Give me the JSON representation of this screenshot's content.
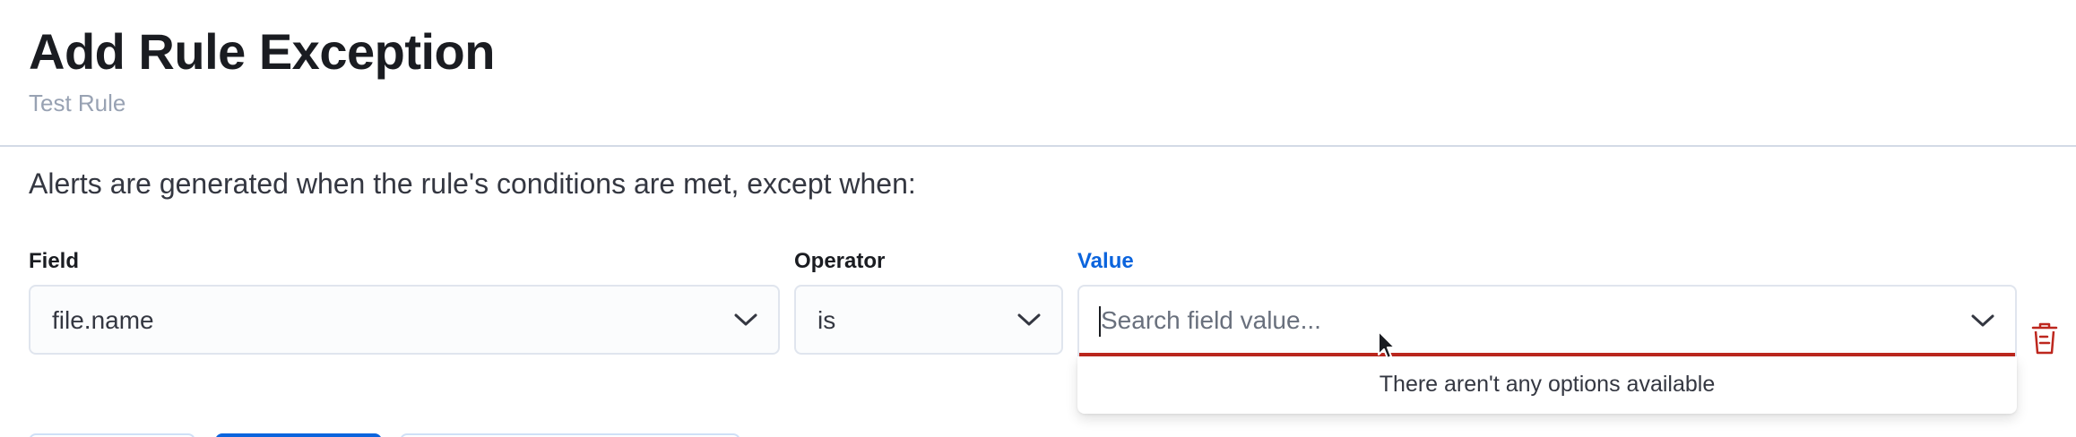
{
  "header": {
    "title": "Add Rule Exception",
    "subtitle": "Test Rule"
  },
  "description": "Alerts are generated when the rule's conditions are met, except when:",
  "condition": {
    "field": {
      "label": "Field",
      "value": "file.name"
    },
    "operator": {
      "label": "Operator",
      "value": "is"
    },
    "value": {
      "label": "Value",
      "placeholder": "Search field value...",
      "dropdown_message": "There aren't any options available"
    }
  },
  "colors": {
    "accent": "#0b64dd",
    "danger": "#bd271e",
    "muted_text": "#98a2b3"
  },
  "icons": {
    "dropdown": "chevron-down-icon",
    "delete": "trash-icon",
    "cursor": "mouse-pointer-icon"
  }
}
